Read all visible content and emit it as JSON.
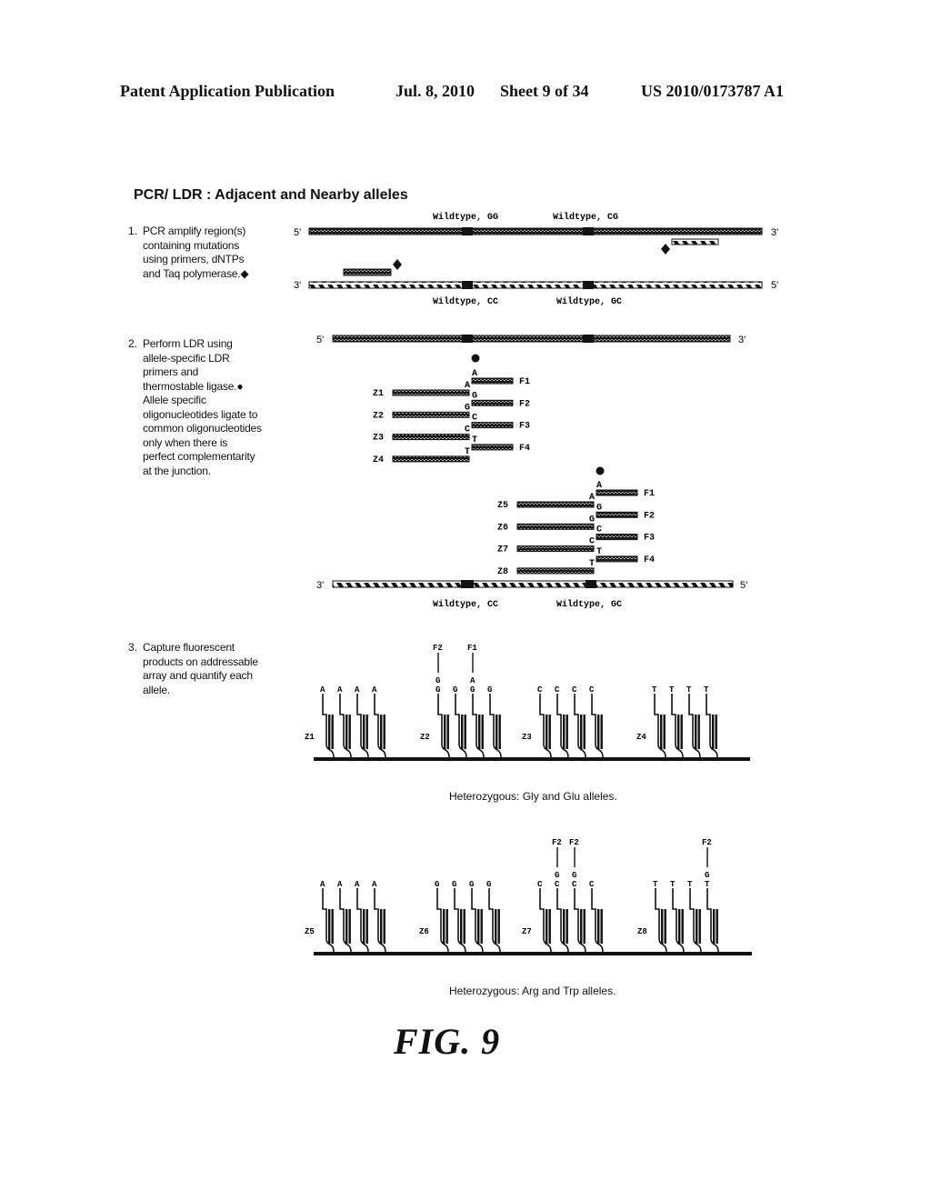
{
  "header": {
    "publication": "Patent Application Publication",
    "date": "Jul. 8, 2010",
    "sheet": "Sheet 9 of 34",
    "patent_number": "US 2010/0173787 A1"
  },
  "title": "PCR/ LDR : Adjacent and Nearby alleles",
  "steps": [
    {
      "num": "1.",
      "text": "PCR amplify region(s)\ncontaining mutations\nusing primers, dNTPs\nand Taq  polymerase.◆"
    },
    {
      "num": "2.",
      "text": "Perform LDR using\nallele-specific LDR\nprimers and\nthermostable ligase.●\nAllele specific\noligonucleotides ligate to\ncommon oligonucleotides\nonly when there is\nperfect complementarity\nat the junction."
    },
    {
      "num": "3.",
      "text": "Capture fluorescent\nproducts on addressable\narray and quantify each\nallele."
    }
  ],
  "strand_ends": {
    "five": "5'",
    "three": "3'"
  },
  "wildtype_labels": {
    "top_left": "Wildtype, GG",
    "top_right": "Wildtype, CG",
    "bottom_left": "Wildtype, CC",
    "bottom_right": "Wildtype, GC"
  },
  "ldr_upper": {
    "z_probes": [
      {
        "label": "Z1",
        "end_base": "A"
      },
      {
        "label": "Z2",
        "end_base": "G"
      },
      {
        "label": "Z3",
        "end_base": "C"
      },
      {
        "label": "Z4",
        "end_base": "T"
      }
    ],
    "f_probes": [
      {
        "label": "F1",
        "start_base": "A"
      },
      {
        "label": "F2",
        "start_base": "G"
      },
      {
        "label": "F3",
        "start_base": "C"
      },
      {
        "label": "F4",
        "start_base": "T"
      }
    ]
  },
  "ldr_lower": {
    "z_probes": [
      {
        "label": "Z5",
        "end_base": "A"
      },
      {
        "label": "Z6",
        "end_base": "G"
      },
      {
        "label": "Z7",
        "end_base": "C"
      },
      {
        "label": "Z8",
        "end_base": "T"
      }
    ],
    "f_probes": [
      {
        "label": "F1",
        "start_base": "A"
      },
      {
        "label": "F2",
        "start_base": "G"
      },
      {
        "label": "F3",
        "start_base": "C"
      },
      {
        "label": "F4",
        "start_base": "T"
      }
    ]
  },
  "arrays": [
    {
      "caption": "Heterozygous: Gly and Glu alleles.",
      "zones": [
        {
          "label": "Z1",
          "bases": [
            "A",
            "A",
            "A",
            "A"
          ],
          "products": [
            null,
            null,
            null,
            null
          ]
        },
        {
          "label": "Z2",
          "bases": [
            "G",
            "G",
            "G",
            "G"
          ],
          "products": [
            {
              "base": "G",
              "tag": "F2"
            },
            null,
            {
              "base": "A",
              "tag": "F1"
            },
            null
          ]
        },
        {
          "label": "Z3",
          "bases": [
            "C",
            "C",
            "C",
            "C"
          ],
          "products": [
            null,
            null,
            null,
            null
          ]
        },
        {
          "label": "Z4",
          "bases": [
            "T",
            "T",
            "T",
            "T"
          ],
          "products": [
            null,
            null,
            null,
            null
          ]
        }
      ]
    },
    {
      "caption": "Heterozygous: Arg and Trp alleles.",
      "zones": [
        {
          "label": "Z5",
          "bases": [
            "A",
            "A",
            "A",
            "A"
          ],
          "products": [
            null,
            null,
            null,
            null
          ]
        },
        {
          "label": "Z6",
          "bases": [
            "G",
            "G",
            "G",
            "G"
          ],
          "products": [
            null,
            null,
            null,
            null
          ]
        },
        {
          "label": "Z7",
          "bases": [
            "C",
            "C",
            "C",
            "C"
          ],
          "products": [
            null,
            {
              "base": "G",
              "tag": "F2"
            },
            {
              "base": "G",
              "tag": "F2"
            },
            null
          ]
        },
        {
          "label": "Z8",
          "bases": [
            "T",
            "T",
            "T",
            "T"
          ],
          "products": [
            null,
            null,
            null,
            {
              "base": "G",
              "tag": "F2"
            }
          ]
        }
      ]
    }
  ],
  "figure_label": "FIG.  9"
}
